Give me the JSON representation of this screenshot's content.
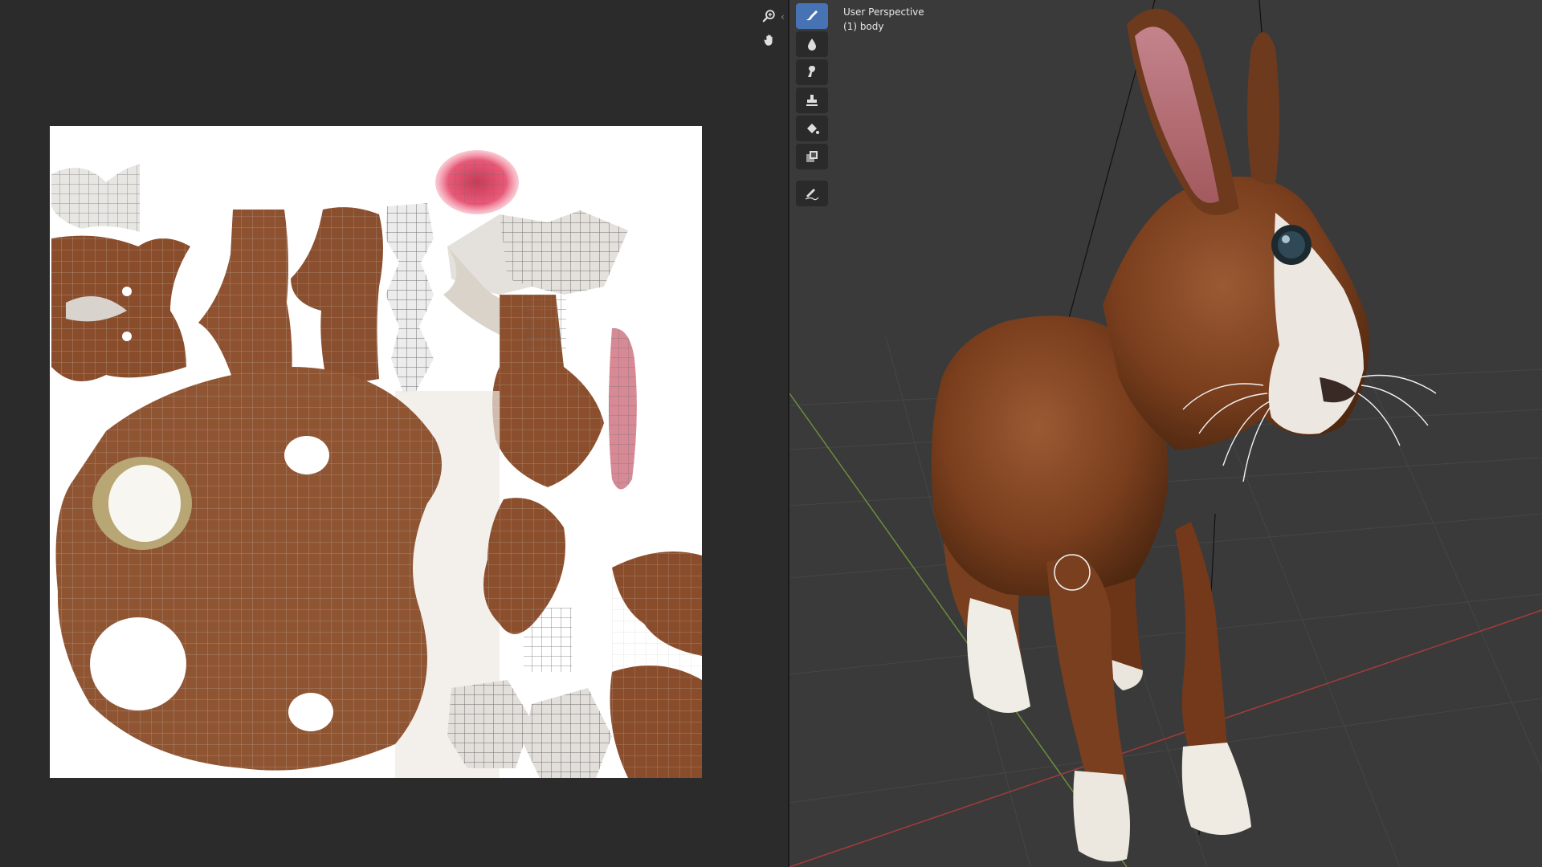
{
  "image_editor": {
    "nav_icons": [
      {
        "name": "zoom-icon"
      },
      {
        "name": "hand-pan-icon"
      }
    ],
    "collapse_glyph": "‹"
  },
  "viewport": {
    "overlay": {
      "view_name": "User Perspective",
      "object_name": "(1) body"
    },
    "tools": [
      {
        "name": "draw-brush-tool",
        "icon": "brush-icon",
        "active": true
      },
      {
        "name": "soften-tool",
        "icon": "drop-icon",
        "active": false
      },
      {
        "name": "smear-tool",
        "icon": "smear-icon",
        "active": false
      },
      {
        "name": "clone-tool",
        "icon": "stamp-icon",
        "active": false
      },
      {
        "name": "fill-tool",
        "icon": "fill-bucket-icon",
        "active": false
      },
      {
        "name": "mask-tool",
        "icon": "mask-icon",
        "active": false
      },
      {
        "name": "annotate-tool",
        "icon": "annotate-pen-icon",
        "active": false
      }
    ]
  },
  "colors": {
    "accent": "#4772b3",
    "background": "#2f2f2f",
    "fur": "#8a4a25",
    "highlight": "#e0506e"
  }
}
